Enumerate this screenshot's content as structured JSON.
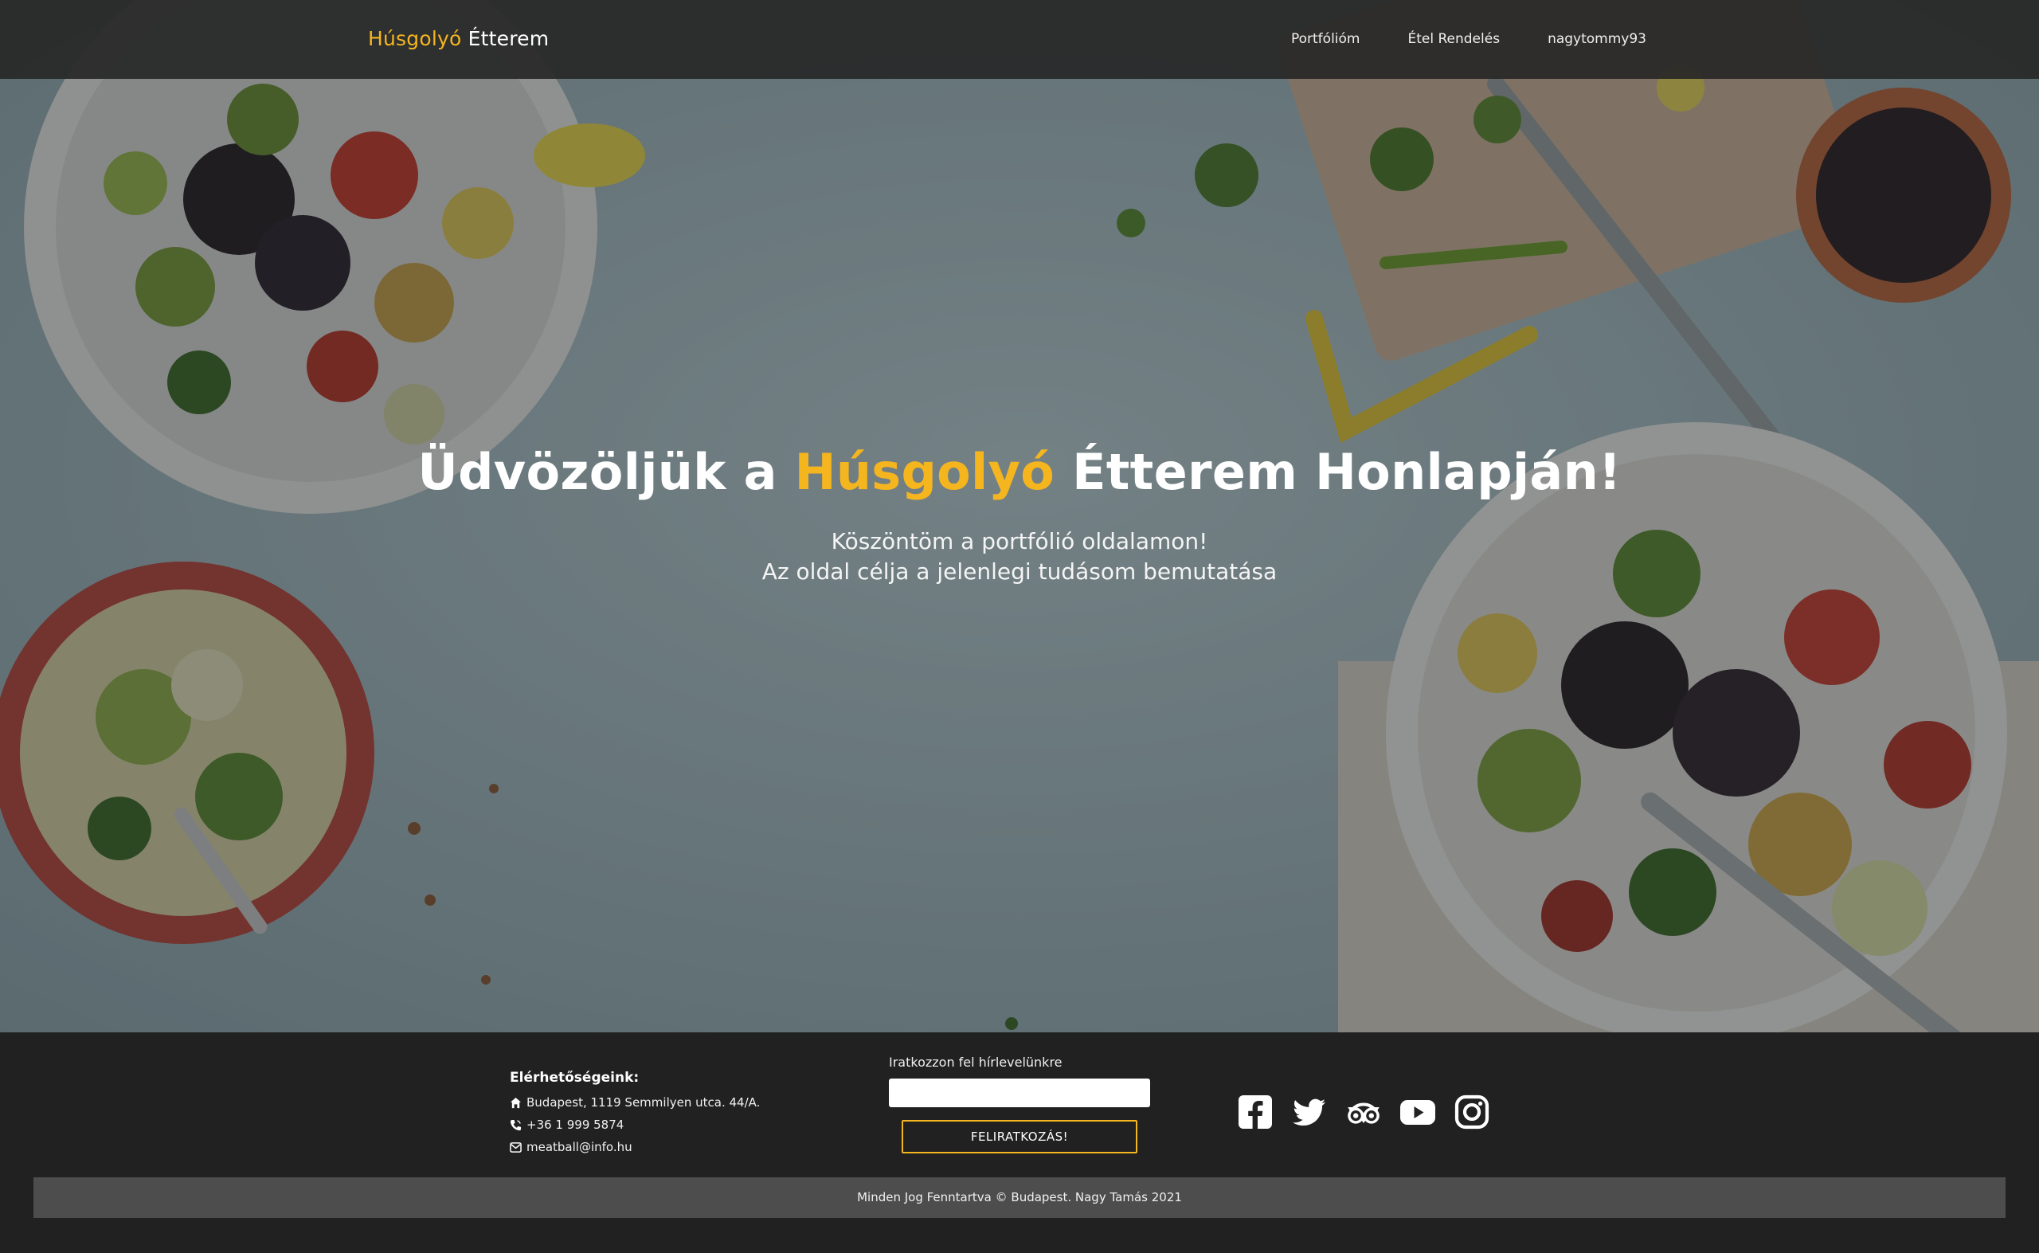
{
  "navbar": {
    "brand_accent": "Húsgolyó",
    "brand_rest": " Étterem",
    "links": [
      "Portfólióm",
      "Étel Rendelés",
      "nagytommy93"
    ]
  },
  "hero": {
    "title_part1": "Üdvözöljük a ",
    "title_accent": "Húsgolyó",
    "title_part2": " Étterem Honlapján!",
    "subtitle_line1": "Köszöntöm a portfólió oldalamon!",
    "subtitle_line2": "Az oldal célja a jelenlegi tudásom bemutatása"
  },
  "footer": {
    "contact_title": "Elérhetőségeink:",
    "address": "Budapest, 1119 Semmilyen utca. 44/A.",
    "phone": "+36 1 999 5874",
    "email": "meatball@info.hu",
    "newsletter_label": "Iratkozzon fel hírlevelünkre",
    "newsletter_value": "",
    "subscribe_label": "FELIRATKOZÁS!",
    "copyright": "Minden Jog Fenntartva © Budapest. Nagy Tamás 2021",
    "social_icons": [
      "facebook-icon",
      "twitter-icon",
      "tripadvisor-icon",
      "youtube-icon",
      "instagram-icon"
    ]
  },
  "colors": {
    "accent": "#f5b51e",
    "navbar_bg": "#282828",
    "footer_bg": "#212121",
    "copyright_bg": "#4d4d4d"
  }
}
